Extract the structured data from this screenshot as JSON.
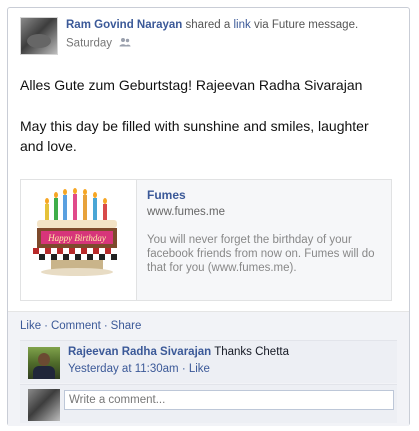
{
  "post": {
    "author": "Ram Govind Narayan",
    "verb_pre": "shared a",
    "link_word": "link",
    "verb_post": "via Future message.",
    "time": "Saturday",
    "privacy_icon": "people-icon",
    "message_line1": "Alles Gute zum Geburtstag! Rajeevan Radha Sivarajan",
    "message_line2": "May this day be filled with sunshine and smiles, laughter and love."
  },
  "share": {
    "title": "Fumes",
    "domain": "www.fumes.me",
    "description": "You will never forget the birthday of your facebook friends from now on. Fumes will do that for you (www.fumes.me).",
    "thumb_text": "Happy Birthday"
  },
  "actions": {
    "like": "Like",
    "comment": "Comment",
    "share": "Share",
    "separator": "·"
  },
  "comment": {
    "author": "Rajeevan Radha Sivarajan",
    "text": "Thanks Chetta",
    "time": "Yesterday at 11:30am",
    "separator": "·",
    "like": "Like"
  },
  "composer": {
    "placeholder": "Write a comment..."
  },
  "colors": {
    "link": "#3b5998",
    "footer_bg": "#f2f3f7",
    "comment_bg": "#edeff4"
  }
}
